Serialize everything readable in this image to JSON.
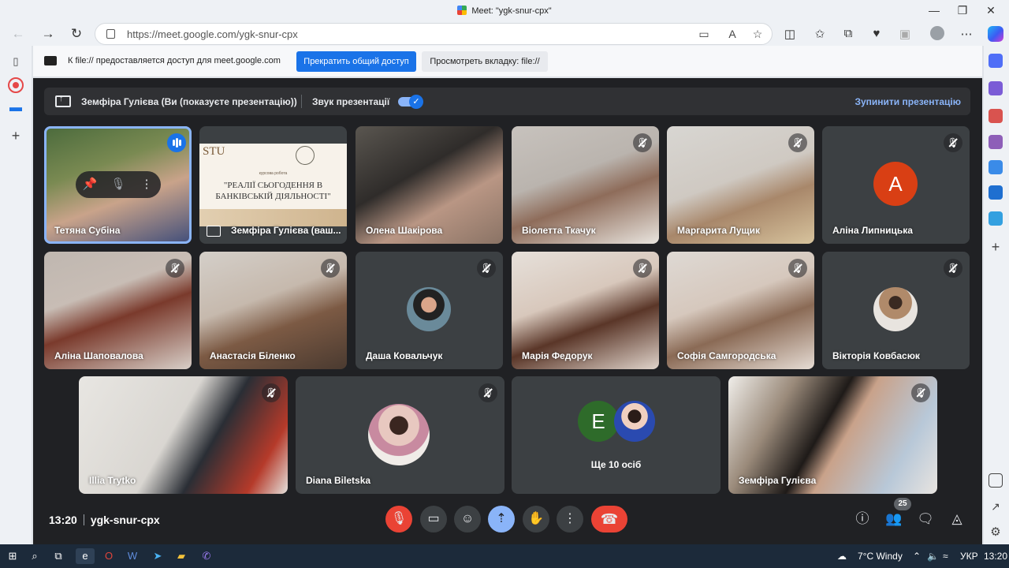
{
  "window": {
    "title": "Meet: \"ygk-snur-cpx\""
  },
  "browser": {
    "url": "https://meet.google.com/ygk-snur-cpx"
  },
  "share_banner": {
    "message": "К file:// предоставляется доступ для meet.google.com",
    "stop_label": "Прекратить общий доступ",
    "view_label": "Просмотреть вкладку: file://"
  },
  "presentation_bar": {
    "presenter": "Земфіра Гулієва (Ви (показуєте презентацію))",
    "audio_label": "Звук презентації",
    "audio_on": true,
    "stop_label": "Зупинити презентацію"
  },
  "slide": {
    "logo": "STU",
    "kicker": "курсова робота",
    "title": "\"РЕАЛІЇ СЬОГОДЕННЯ В БАНКІВСЬКІЙ ДІЯЛЬНОСТІ\""
  },
  "participants": [
    {
      "name": "Тетяна Субіна",
      "kind": "video",
      "speaking": true
    },
    {
      "name": "Земфіра Гулієва (ваш...",
      "kind": "presentation"
    },
    {
      "name": "Олена Шакірова",
      "kind": "video"
    },
    {
      "name": "Віолетта Ткачук",
      "kind": "video",
      "muted": true
    },
    {
      "name": "Маргарита Лущик",
      "kind": "video",
      "muted": true
    },
    {
      "name": "Аліна Липницька",
      "kind": "letter",
      "letter": "A",
      "muted": true
    },
    {
      "name": "Аліна Шаповалова",
      "kind": "video",
      "muted": true
    },
    {
      "name": "Анастасія Біленко",
      "kind": "video",
      "muted": true
    },
    {
      "name": "Даша Ковальчук",
      "kind": "avatar",
      "muted": true
    },
    {
      "name": "Марія Федорук",
      "kind": "video",
      "muted": true
    },
    {
      "name": "Софія Самгородська",
      "kind": "video",
      "muted": true
    },
    {
      "name": "Вікторія Ковбасюк",
      "kind": "avatar",
      "muted": true
    },
    {
      "name": "Illia Trytko",
      "kind": "video",
      "muted": true
    },
    {
      "name": "Diana Biletska",
      "kind": "avatar",
      "muted": true
    },
    {
      "name": "Ще 10 осіб",
      "kind": "more",
      "letter": "E"
    },
    {
      "name": "Земфіра Гулієва",
      "kind": "video",
      "muted": true
    }
  ],
  "controls": {
    "time": "13:20",
    "meeting_code": "ygk-snur-cpx",
    "participant_count": "25"
  },
  "taskbar": {
    "weather": "7°C  Windy",
    "language": "УКР",
    "clock": "13:20"
  }
}
